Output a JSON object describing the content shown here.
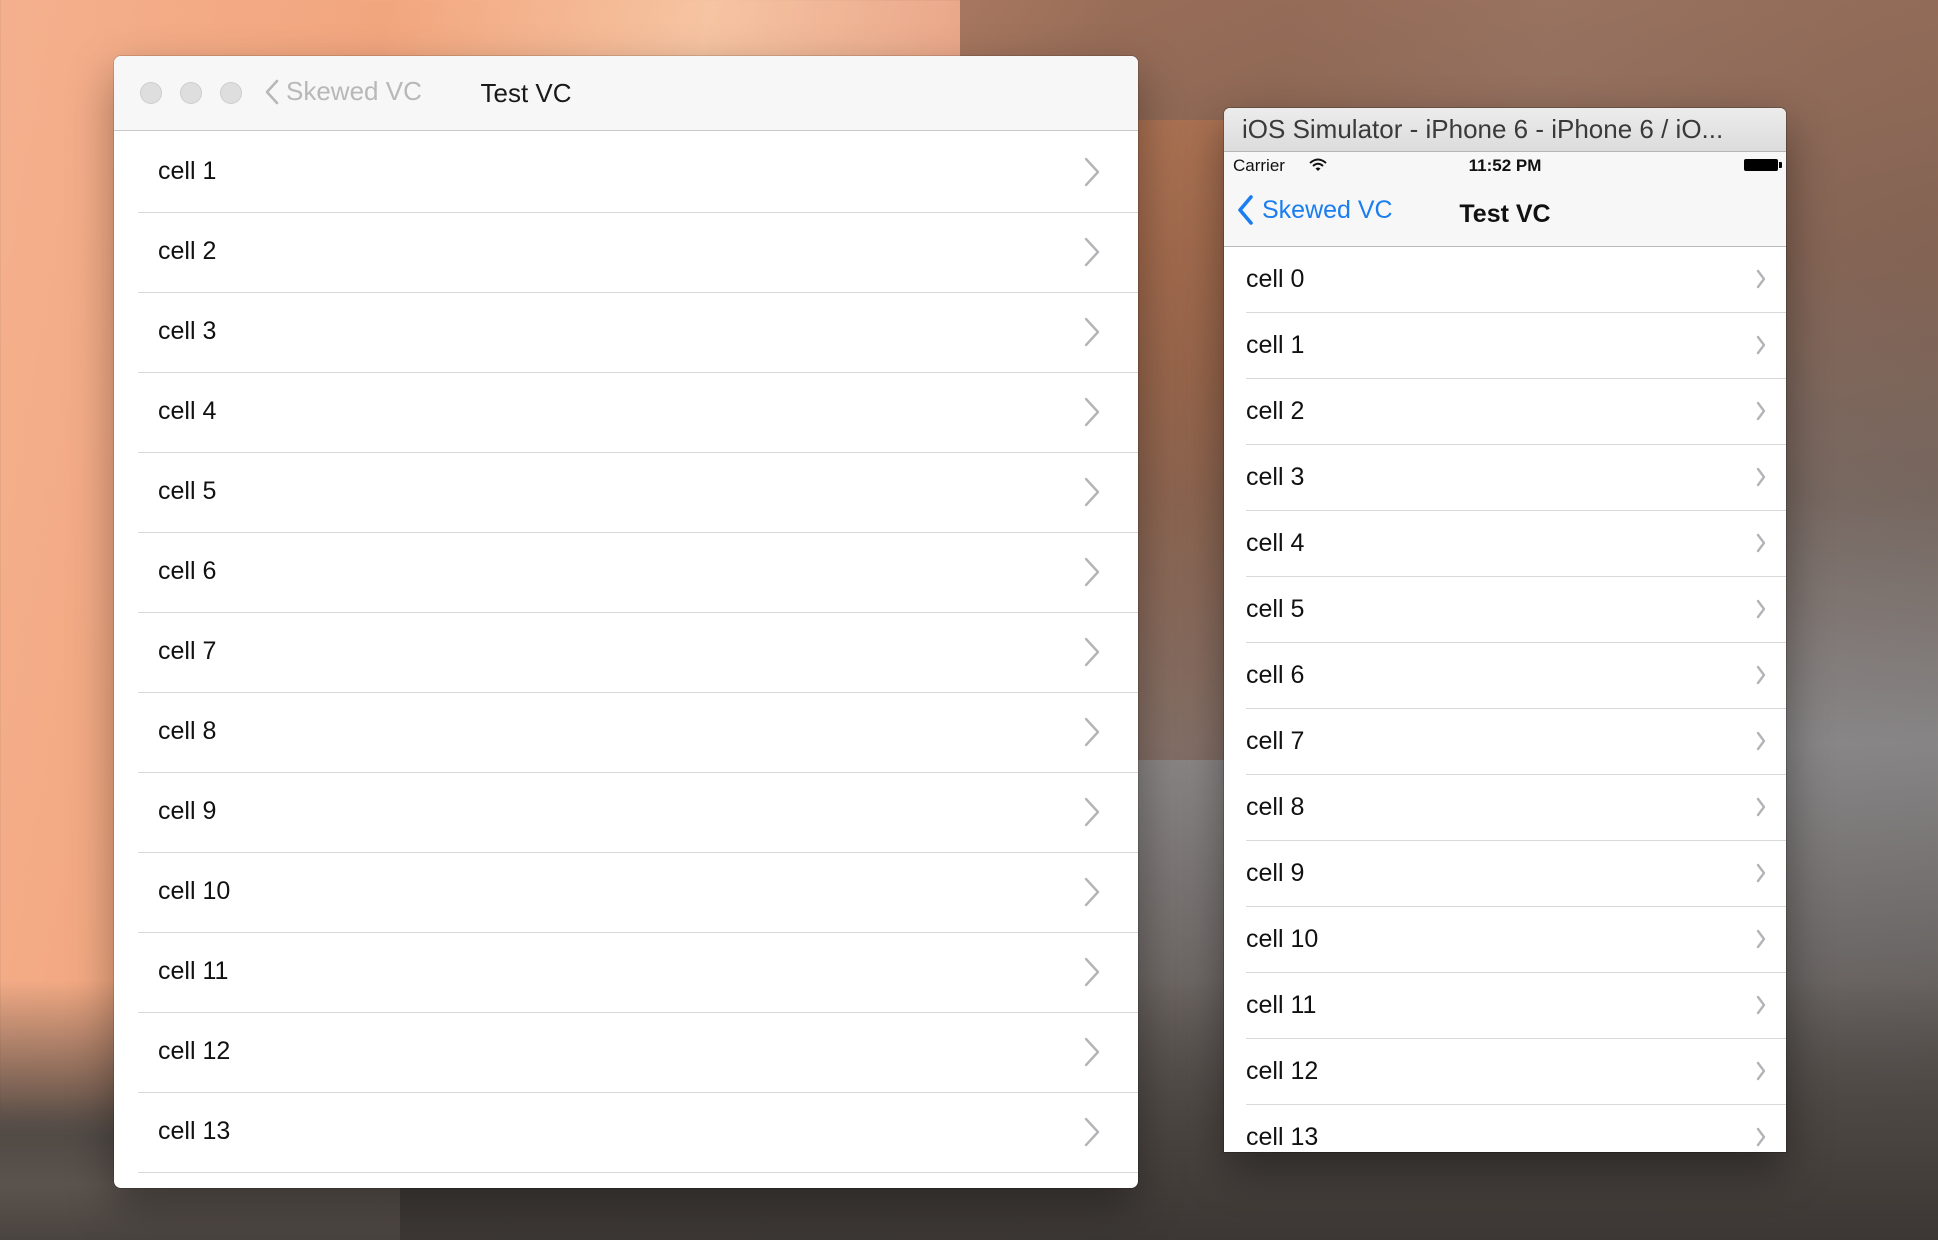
{
  "left_window": {
    "back_label": "Skewed VC",
    "title": "Test VC",
    "cells": [
      "cell 1",
      "cell 2",
      "cell 3",
      "cell 4",
      "cell 5",
      "cell 6",
      "cell 7",
      "cell 8",
      "cell 9",
      "cell 10",
      "cell 11",
      "cell 12",
      "cell 13"
    ]
  },
  "simulator": {
    "window_title": "iOS Simulator - iPhone 6 - iPhone 6 / iO...",
    "status": {
      "carrier": "Carrier",
      "time": "11:52 PM"
    },
    "nav": {
      "back_label": "Skewed VC",
      "title": "Test VC"
    },
    "cells": [
      "cell 0",
      "cell 1",
      "cell 2",
      "cell 3",
      "cell 4",
      "cell 5",
      "cell 6",
      "cell 7",
      "cell 8",
      "cell 9",
      "cell 10",
      "cell 11",
      "cell 12",
      "cell 13"
    ]
  },
  "colors": {
    "ios_tint": "#1a7ef0",
    "disabled_back": "#b8b8b8",
    "separator": "#d9d9d9"
  }
}
